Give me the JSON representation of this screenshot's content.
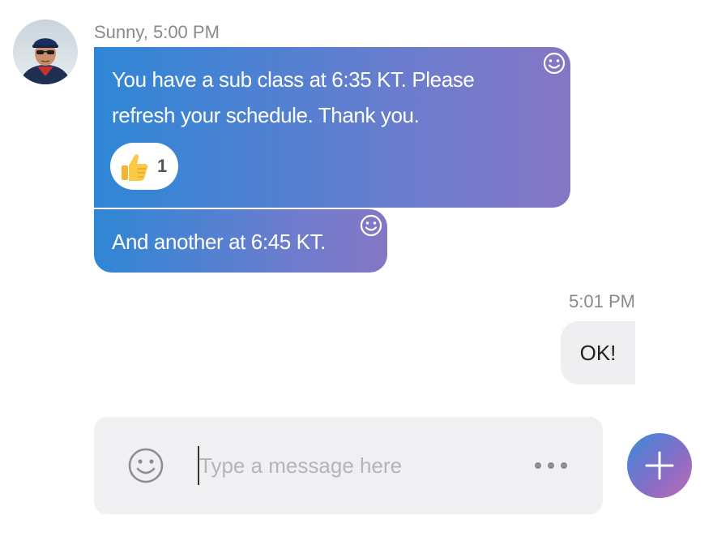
{
  "incoming": {
    "sender_meta": "Sunny, 5:00 PM",
    "avatar_icon": "user-photo-avatar",
    "messages": [
      {
        "text": "You have a sub class at 6:35 KT. Please refresh your schedule. Thank you.",
        "reaction": {
          "emoji_icon": "thumbs-up-icon",
          "count": "1"
        }
      },
      {
        "text": "And another at 6:45 KT."
      }
    ],
    "add_reaction_icon": "smiley-icon"
  },
  "outgoing": {
    "meta": "5:01 PM",
    "messages": [
      {
        "text": "OK!"
      }
    ]
  },
  "composer": {
    "placeholder": "Type a message here",
    "value": "",
    "emoji_icon": "smiley-icon",
    "more_icon": "more-dots-icon",
    "add_icon": "plus-icon"
  },
  "colors": {
    "incoming_gradient_start": "#2f86d6",
    "incoming_gradient_end": "#8576c4",
    "outgoing_bubble": "#efeff2",
    "composer_bg": "#f0f0f2",
    "meta_text": "#8a8a8a"
  }
}
